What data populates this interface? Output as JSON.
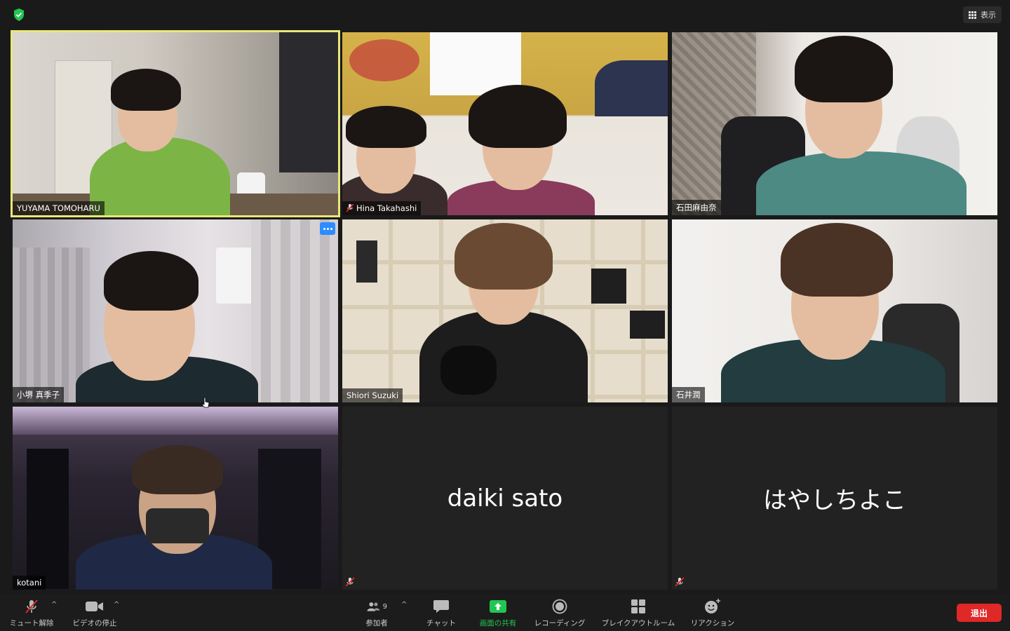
{
  "top_bar": {
    "view_label": "表示"
  },
  "participants": [
    {
      "name": "YUYAMA TOMOHARU",
      "muted": false,
      "active_speaker": true
    },
    {
      "name": "Hina Takahashi",
      "muted": true
    },
    {
      "name": "石田麻由奈",
      "muted": false
    },
    {
      "name": "小堺 真季子",
      "muted": false
    },
    {
      "name": "Shiori Suzuki",
      "muted": false
    },
    {
      "name": "石井潤",
      "muted": false
    },
    {
      "name": "kotani",
      "muted": false
    },
    {
      "name": "daiki sato",
      "muted": true,
      "video_off": true
    },
    {
      "name": "はやしちよこ",
      "muted": true,
      "video_off": true
    }
  ],
  "toolbar": {
    "unmute_label": "ミュート解除",
    "stop_video_label": "ビデオの停止",
    "participants_label": "参加者",
    "participants_count": "9",
    "chat_label": "チャット",
    "share_label": "画面の共有",
    "record_label": "レコーディング",
    "breakout_label": "ブレイクアウトルーム",
    "reactions_label": "リアクション",
    "leave_label": "退出"
  },
  "colors": {
    "active_speaker_border": "#e9e77a",
    "share_green": "#23c552",
    "leave_red": "#e02828",
    "more_button_blue": "#2d8cff"
  }
}
